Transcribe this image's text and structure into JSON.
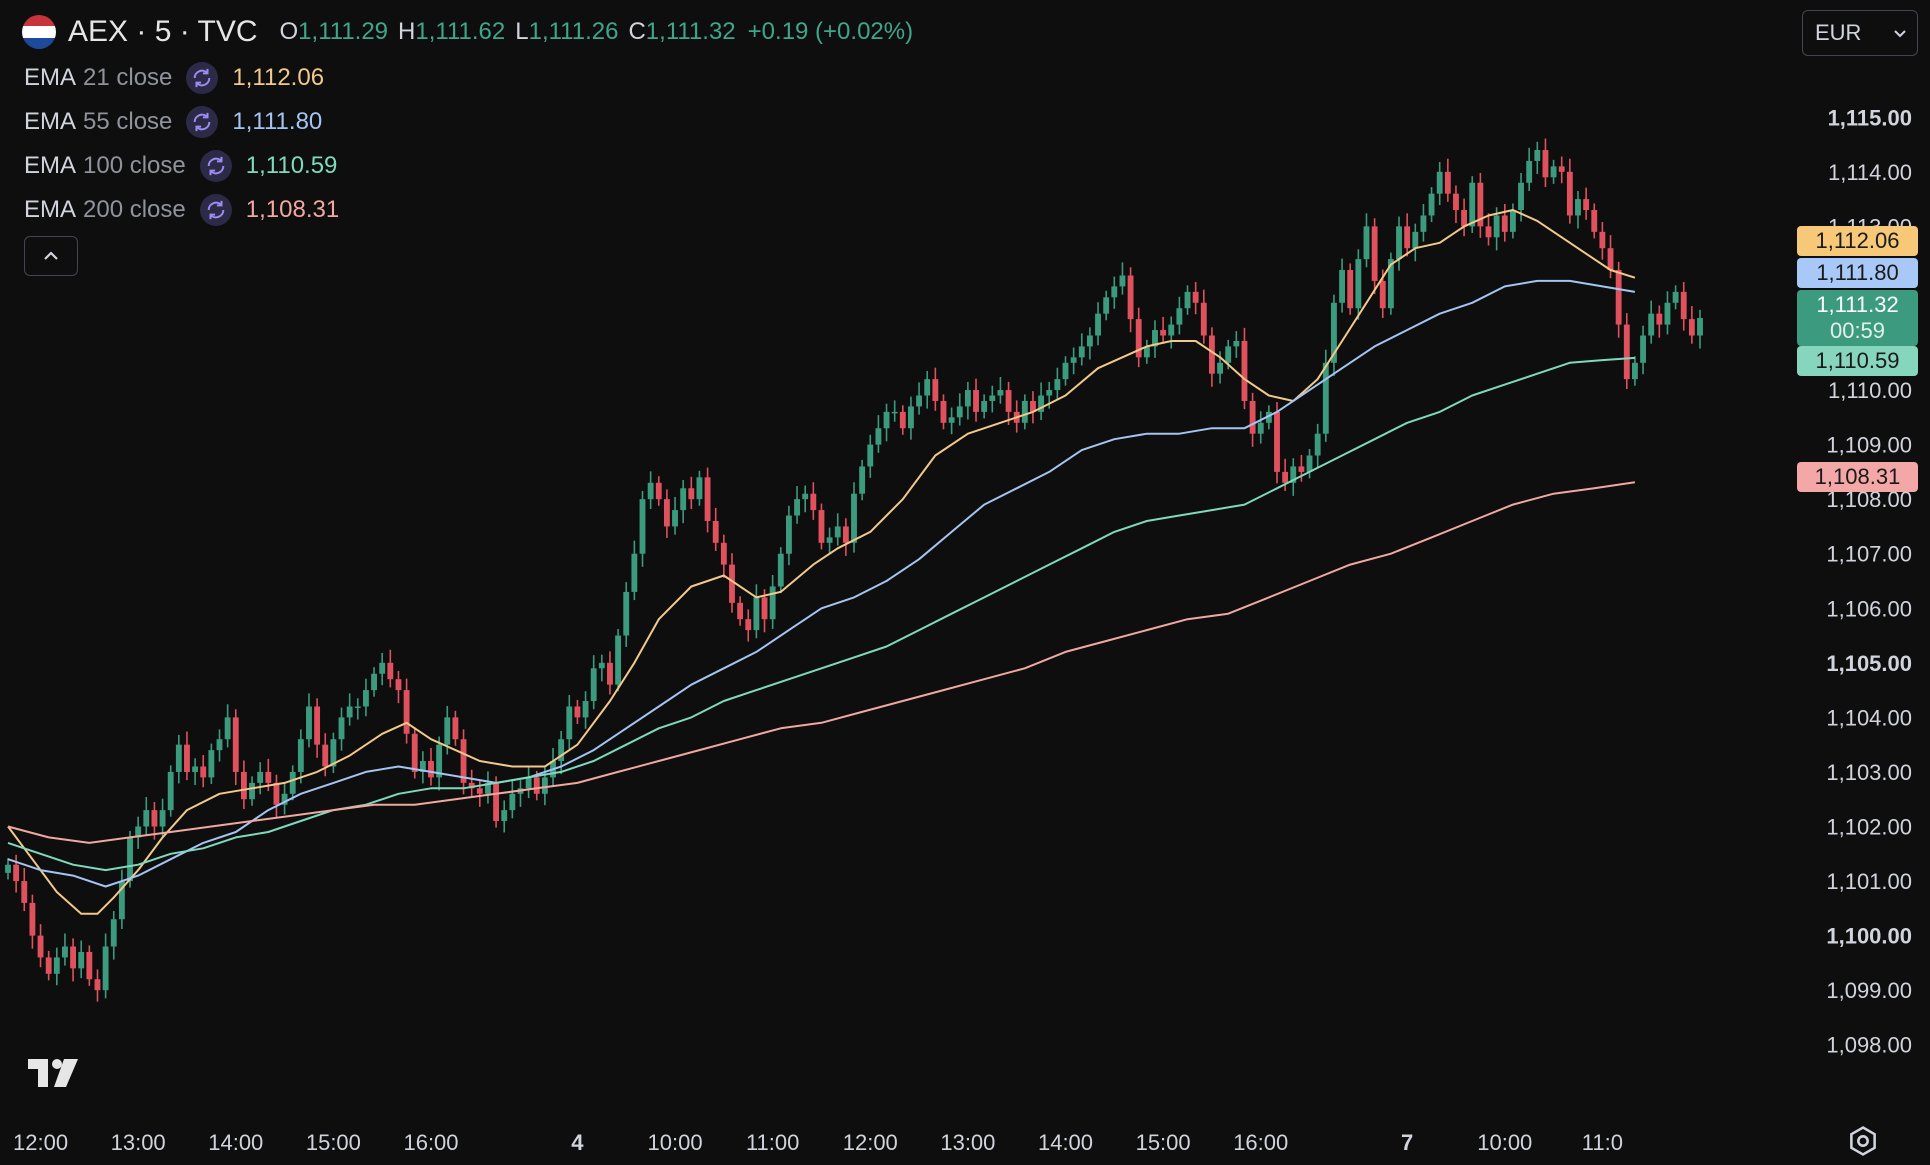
{
  "symbol": {
    "title": "AEX · 5 · TVC",
    "ohlc": [
      {
        "label": "O",
        "value": "1,111.29"
      },
      {
        "label": "H",
        "value": "1,111.62"
      },
      {
        "label": "L",
        "value": "1,111.26"
      },
      {
        "label": "C",
        "value": "1,111.32"
      }
    ],
    "change": "+0.19 (+0.02%)",
    "flag_colors": [
      "#c8343b",
      "#ffffff",
      "#1f4a9c"
    ]
  },
  "indicators": [
    {
      "name": "EMA",
      "params": "21 close",
      "value": "1,112.06",
      "color": "#f2c98a"
    },
    {
      "name": "EMA",
      "params": "55 close",
      "value": "1,111.80",
      "color": "#a4c4f2"
    },
    {
      "name": "EMA",
      "params": "100 close",
      "value": "1,110.59",
      "color": "#7fd9bc"
    },
    {
      "name": "EMA",
      "params": "200 close",
      "value": "1,108.31",
      "color": "#f0a8a0"
    }
  ],
  "currency": {
    "label": "EUR"
  },
  "price_tags": [
    {
      "value": "1,112.06",
      "price": 1112.06,
      "bg": "#f6c878",
      "fg": "#1a1a1a"
    },
    {
      "value": "1,111.80",
      "price": 1111.8,
      "bg": "#a8c8f8",
      "fg": "#1a1a1a"
    },
    {
      "value": "1,111.32",
      "price": 1111.32,
      "bg": "#3c9b7e",
      "fg": "#ffffff",
      "countdown": "00:59"
    },
    {
      "value": "1,110.59",
      "price": 1110.59,
      "bg": "#86d6bd",
      "fg": "#1a1a1a"
    },
    {
      "value": "1,108.31",
      "price": 1108.31,
      "bg": "#f4a7a7",
      "fg": "#1a1a1a"
    }
  ],
  "colors": {
    "up": "#3c9b7e",
    "down": "#e0515e",
    "background": "#0e0e0e",
    "axis_text": "#d1d4dc"
  },
  "chart_data": {
    "type": "candlestick",
    "ylim": [
      1097.5,
      1115.5
    ],
    "y_ticks": [
      {
        "label": "1,115.00",
        "value": 1115,
        "bold": true
      },
      {
        "label": "1,114.00",
        "value": 1114
      },
      {
        "label": "1,113.00",
        "value": 1113
      },
      {
        "label": "1,110.00",
        "value": 1110
      },
      {
        "label": "1,109.00",
        "value": 1109
      },
      {
        "label": "1,108.00",
        "value": 1108
      },
      {
        "label": "1,107.00",
        "value": 1107
      },
      {
        "label": "1,106.00",
        "value": 1106
      },
      {
        "label": "1,105.00",
        "value": 1105,
        "bold": true
      },
      {
        "label": "1,104.00",
        "value": 1104
      },
      {
        "label": "1,103.00",
        "value": 1103
      },
      {
        "label": "1,102.00",
        "value": 1102
      },
      {
        "label": "1,101.00",
        "value": 1101
      },
      {
        "label": "1,100.00",
        "value": 1100,
        "bold": true
      },
      {
        "label": "1,099.00",
        "value": 1099
      },
      {
        "label": "1,098.00",
        "value": 1098
      }
    ],
    "x_ticks": [
      {
        "label": "12:00",
        "bar": 4
      },
      {
        "label": "13:00",
        "bar": 16
      },
      {
        "label": "14:00",
        "bar": 28
      },
      {
        "label": "15:00",
        "bar": 40
      },
      {
        "label": "16:00",
        "bar": 52
      },
      {
        "label": "4",
        "bar": 70,
        "bold": true
      },
      {
        "label": "10:00",
        "bar": 82
      },
      {
        "label": "11:00",
        "bar": 94
      },
      {
        "label": "12:00",
        "bar": 106
      },
      {
        "label": "13:00",
        "bar": 118
      },
      {
        "label": "14:00",
        "bar": 130
      },
      {
        "label": "15:00",
        "bar": 142
      },
      {
        "label": "16:00",
        "bar": 154
      },
      {
        "label": "7",
        "bar": 172,
        "bold": true
      },
      {
        "label": "10:00",
        "bar": 184
      },
      {
        "label": "11:0",
        "bar": 196
      }
    ],
    "closes": [
      1101.3,
      1101.0,
      1100.6,
      1100.0,
      1099.6,
      1099.3,
      1099.6,
      1099.8,
      1099.4,
      1099.7,
      1099.2,
      1099.0,
      1099.8,
      1100.3,
      1101.0,
      1101.8,
      1102.0,
      1102.3,
      1102.0,
      1102.3,
      1103.0,
      1103.5,
      1103.0,
      1103.1,
      1102.9,
      1103.4,
      1103.6,
      1104.0,
      1103.0,
      1102.5,
      1102.8,
      1103.0,
      1102.8,
      1102.4,
      1102.6,
      1103.0,
      1103.6,
      1104.2,
      1103.5,
      1103.1,
      1103.6,
      1104.0,
      1104.2,
      1104.2,
      1104.5,
      1104.8,
      1105.0,
      1104.7,
      1104.5,
      1103.7,
      1103.0,
      1103.2,
      1102.9,
      1103.5,
      1104.0,
      1103.6,
      1102.8,
      1102.7,
      1102.6,
      1102.8,
      1102.1,
      1102.3,
      1102.6,
      1102.7,
      1102.9,
      1102.6,
      1102.9,
      1103.2,
      1103.6,
      1104.2,
      1104.0,
      1104.3,
      1104.9,
      1105.0,
      1104.6,
      1105.5,
      1106.3,
      1107.0,
      1108.0,
      1108.3,
      1108.0,
      1107.5,
      1107.8,
      1108.2,
      1108.0,
      1108.4,
      1107.6,
      1107.2,
      1106.8,
      1106.1,
      1105.8,
      1105.6,
      1106.2,
      1105.8,
      1106.4,
      1107.0,
      1107.7,
      1108.0,
      1108.1,
      1107.8,
      1107.2,
      1107.3,
      1107.5,
      1107.2,
      1108.1,
      1108.6,
      1109.0,
      1109.3,
      1109.6,
      1109.6,
      1109.3,
      1109.7,
      1109.9,
      1110.2,
      1109.8,
      1109.4,
      1109.5,
      1109.7,
      1110.0,
      1109.6,
      1109.8,
      1109.9,
      1110.0,
      1109.6,
      1109.4,
      1109.8,
      1109.6,
      1109.9,
      1110.0,
      1110.2,
      1110.5,
      1110.6,
      1110.8,
      1111.0,
      1111.4,
      1111.7,
      1111.9,
      1112.1,
      1111.3,
      1110.6,
      1110.8,
      1111.1,
      1111.0,
      1111.2,
      1111.5,
      1111.8,
      1111.6,
      1111.0,
      1110.3,
      1110.5,
      1110.8,
      1110.9,
      1109.8,
      1109.2,
      1109.4,
      1109.6,
      1108.5,
      1108.3,
      1108.6,
      1108.5,
      1108.8,
      1109.2,
      1110.5,
      1111.6,
      1112.2,
      1111.5,
      1112.4,
      1113.0,
      1112.0,
      1111.5,
      1112.4,
      1113.0,
      1112.6,
      1112.9,
      1113.2,
      1113.6,
      1114.0,
      1113.6,
      1113.3,
      1113.0,
      1113.8,
      1113.0,
      1112.8,
      1113.2,
      1112.9,
      1113.3,
      1113.8,
      1114.2,
      1114.4,
      1113.9,
      1114.1,
      1114.0,
      1113.2,
      1113.5,
      1113.3,
      1112.9,
      1112.6,
      1112.2,
      1111.2,
      1110.2,
      1110.5,
      1111.0,
      1111.4,
      1111.2,
      1111.6,
      1111.8,
      1111.3,
      1111.0,
      1111.32
    ],
    "ema21": [
      [
        0,
        1102.0
      ],
      [
        3,
        1101.4
      ],
      [
        6,
        1100.8
      ],
      [
        9,
        1100.4
      ],
      [
        11,
        1100.4
      ],
      [
        13,
        1100.7
      ],
      [
        16,
        1101.2
      ],
      [
        19,
        1101.8
      ],
      [
        22,
        1102.3
      ],
      [
        26,
        1102.6
      ],
      [
        30,
        1102.7
      ],
      [
        34,
        1102.8
      ],
      [
        38,
        1103.0
      ],
      [
        42,
        1103.3
      ],
      [
        46,
        1103.7
      ],
      [
        49,
        1103.9
      ],
      [
        52,
        1103.6
      ],
      [
        55,
        1103.4
      ],
      [
        58,
        1103.2
      ],
      [
        62,
        1103.1
      ],
      [
        66,
        1103.1
      ],
      [
        70,
        1103.5
      ],
      [
        74,
        1104.3
      ],
      [
        77,
        1105.0
      ],
      [
        80,
        1105.8
      ],
      [
        84,
        1106.4
      ],
      [
        88,
        1106.6
      ],
      [
        92,
        1106.2
      ],
      [
        95,
        1106.3
      ],
      [
        99,
        1106.8
      ],
      [
        102,
        1107.1
      ],
      [
        106,
        1107.4
      ],
      [
        110,
        1108.0
      ],
      [
        114,
        1108.8
      ],
      [
        118,
        1109.2
      ],
      [
        122,
        1109.4
      ],
      [
        126,
        1109.6
      ],
      [
        130,
        1109.9
      ],
      [
        134,
        1110.4
      ],
      [
        137,
        1110.6
      ],
      [
        140,
        1110.8
      ],
      [
        143,
        1110.9
      ],
      [
        146,
        1110.9
      ],
      [
        149,
        1110.6
      ],
      [
        152,
        1110.2
      ],
      [
        155,
        1109.9
      ],
      [
        158,
        1109.8
      ],
      [
        161,
        1110.2
      ],
      [
        164,
        1110.9
      ],
      [
        167,
        1111.6
      ],
      [
        170,
        1112.3
      ],
      [
        173,
        1112.6
      ],
      [
        176,
        1112.7
      ],
      [
        179,
        1113.0
      ],
      [
        182,
        1113.2
      ],
      [
        185,
        1113.3
      ],
      [
        188,
        1113.1
      ],
      [
        191,
        1112.8
      ],
      [
        194,
        1112.5
      ],
      [
        197,
        1112.2
      ],
      [
        200,
        1112.06
      ]
    ],
    "ema55": [
      [
        0,
        1101.4
      ],
      [
        4,
        1101.2
      ],
      [
        8,
        1101.1
      ],
      [
        12,
        1100.9
      ],
      [
        16,
        1101.1
      ],
      [
        20,
        1101.4
      ],
      [
        24,
        1101.7
      ],
      [
        28,
        1101.9
      ],
      [
        32,
        1102.3
      ],
      [
        36,
        1102.6
      ],
      [
        40,
        1102.8
      ],
      [
        44,
        1103.0
      ],
      [
        48,
        1103.1
      ],
      [
        52,
        1103.0
      ],
      [
        56,
        1102.9
      ],
      [
        60,
        1102.8
      ],
      [
        64,
        1102.9
      ],
      [
        68,
        1103.1
      ],
      [
        72,
        1103.4
      ],
      [
        76,
        1103.8
      ],
      [
        80,
        1104.2
      ],
      [
        84,
        1104.6
      ],
      [
        88,
        1104.9
      ],
      [
        92,
        1105.2
      ],
      [
        96,
        1105.6
      ],
      [
        100,
        1106.0
      ],
      [
        104,
        1106.2
      ],
      [
        108,
        1106.5
      ],
      [
        112,
        1106.9
      ],
      [
        116,
        1107.4
      ],
      [
        120,
        1107.9
      ],
      [
        124,
        1108.2
      ],
      [
        128,
        1108.5
      ],
      [
        132,
        1108.9
      ],
      [
        136,
        1109.1
      ],
      [
        140,
        1109.2
      ],
      [
        144,
        1109.2
      ],
      [
        148,
        1109.3
      ],
      [
        152,
        1109.3
      ],
      [
        156,
        1109.6
      ],
      [
        160,
        1110.0
      ],
      [
        164,
        1110.4
      ],
      [
        168,
        1110.8
      ],
      [
        172,
        1111.1
      ],
      [
        176,
        1111.4
      ],
      [
        180,
        1111.6
      ],
      [
        184,
        1111.9
      ],
      [
        188,
        1112.0
      ],
      [
        192,
        1112.0
      ],
      [
        196,
        1111.9
      ],
      [
        200,
        1111.8
      ]
    ],
    "ema100": [
      [
        0,
        1101.7
      ],
      [
        4,
        1101.5
      ],
      [
        8,
        1101.3
      ],
      [
        12,
        1101.2
      ],
      [
        16,
        1101.3
      ],
      [
        20,
        1101.5
      ],
      [
        24,
        1101.6
      ],
      [
        28,
        1101.8
      ],
      [
        32,
        1101.9
      ],
      [
        36,
        1102.1
      ],
      [
        40,
        1102.3
      ],
      [
        44,
        1102.4
      ],
      [
        48,
        1102.6
      ],
      [
        52,
        1102.7
      ],
      [
        56,
        1102.7
      ],
      [
        60,
        1102.8
      ],
      [
        64,
        1102.9
      ],
      [
        68,
        1103.0
      ],
      [
        72,
        1103.2
      ],
      [
        76,
        1103.5
      ],
      [
        80,
        1103.8
      ],
      [
        84,
        1104.0
      ],
      [
        88,
        1104.3
      ],
      [
        92,
        1104.5
      ],
      [
        96,
        1104.7
      ],
      [
        100,
        1104.9
      ],
      [
        104,
        1105.1
      ],
      [
        108,
        1105.3
      ],
      [
        112,
        1105.6
      ],
      [
        116,
        1105.9
      ],
      [
        120,
        1106.2
      ],
      [
        124,
        1106.5
      ],
      [
        128,
        1106.8
      ],
      [
        132,
        1107.1
      ],
      [
        136,
        1107.4
      ],
      [
        140,
        1107.6
      ],
      [
        144,
        1107.7
      ],
      [
        148,
        1107.8
      ],
      [
        152,
        1107.9
      ],
      [
        156,
        1108.2
      ],
      [
        160,
        1108.5
      ],
      [
        164,
        1108.8
      ],
      [
        168,
        1109.1
      ],
      [
        172,
        1109.4
      ],
      [
        176,
        1109.6
      ],
      [
        180,
        1109.9
      ],
      [
        184,
        1110.1
      ],
      [
        188,
        1110.3
      ],
      [
        192,
        1110.5
      ],
      [
        196,
        1110.55
      ],
      [
        200,
        1110.59
      ]
    ],
    "ema200": [
      [
        0,
        1102.0
      ],
      [
        5,
        1101.8
      ],
      [
        10,
        1101.7
      ],
      [
        15,
        1101.8
      ],
      [
        20,
        1101.9
      ],
      [
        25,
        1102.0
      ],
      [
        30,
        1102.1
      ],
      [
        35,
        1102.2
      ],
      [
        40,
        1102.3
      ],
      [
        45,
        1102.4
      ],
      [
        50,
        1102.4
      ],
      [
        55,
        1102.5
      ],
      [
        60,
        1102.6
      ],
      [
        65,
        1102.7
      ],
      [
        70,
        1102.8
      ],
      [
        75,
        1103.0
      ],
      [
        80,
        1103.2
      ],
      [
        85,
        1103.4
      ],
      [
        90,
        1103.6
      ],
      [
        95,
        1103.8
      ],
      [
        100,
        1103.9
      ],
      [
        105,
        1104.1
      ],
      [
        110,
        1104.3
      ],
      [
        115,
        1104.5
      ],
      [
        120,
        1104.7
      ],
      [
        125,
        1104.9
      ],
      [
        130,
        1105.2
      ],
      [
        135,
        1105.4
      ],
      [
        140,
        1105.6
      ],
      [
        145,
        1105.8
      ],
      [
        150,
        1105.9
      ],
      [
        155,
        1106.2
      ],
      [
        160,
        1106.5
      ],
      [
        165,
        1106.8
      ],
      [
        170,
        1107.0
      ],
      [
        175,
        1107.3
      ],
      [
        180,
        1107.6
      ],
      [
        185,
        1107.9
      ],
      [
        190,
        1108.1
      ],
      [
        195,
        1108.2
      ],
      [
        200,
        1108.31
      ]
    ]
  }
}
